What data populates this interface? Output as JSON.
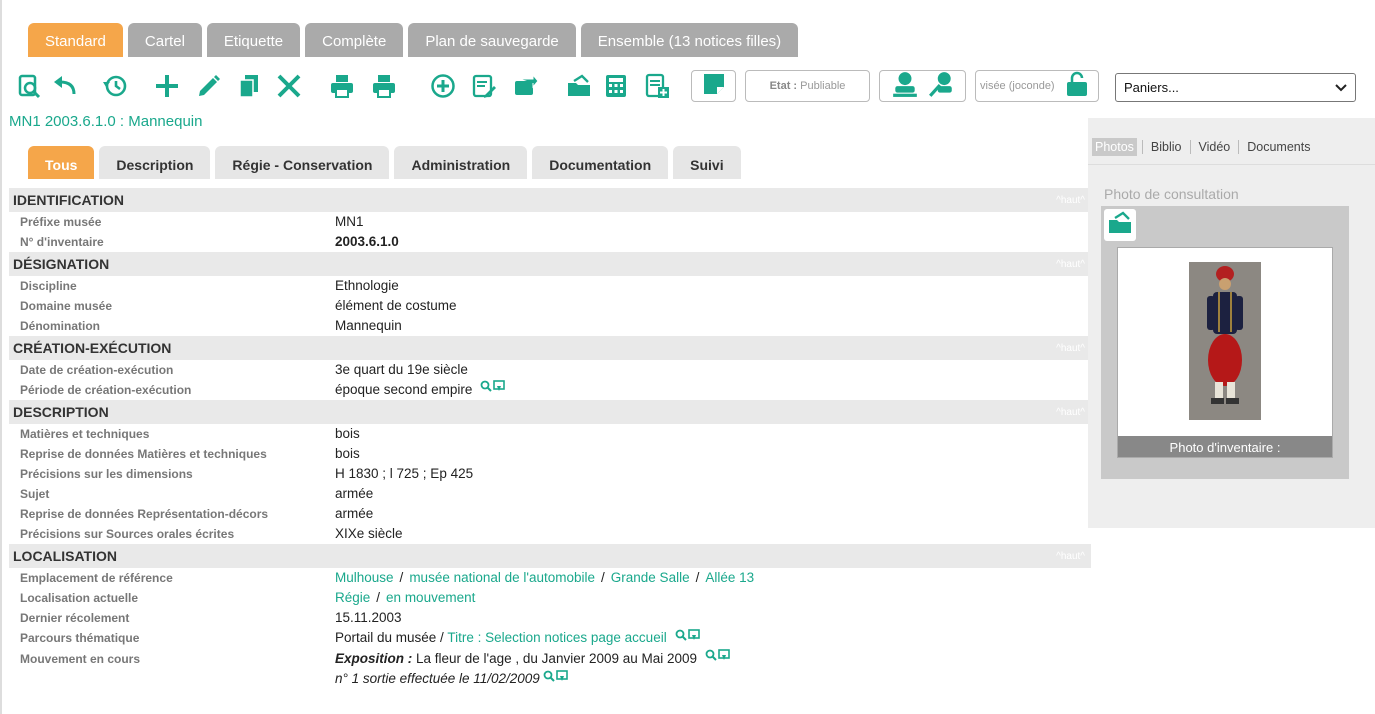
{
  "colors": {
    "accent": "#f5a64a",
    "teal": "#1aa88c",
    "inactive_tab": "#aaaaaa"
  },
  "top_tabs": [
    {
      "label": "Standard",
      "active": true
    },
    {
      "label": "Cartel"
    },
    {
      "label": "Etiquette"
    },
    {
      "label": "Complète"
    },
    {
      "label": "Plan de sauvegarde"
    },
    {
      "label": "Ensemble (13 notices filles)"
    }
  ],
  "toolbar": {
    "icons": [
      "search-document-icon",
      "undo-icon",
      "history-icon",
      "add-icon",
      "edit-icon",
      "copy-icon",
      "delete-icon",
      "print-icon",
      "print-alt-icon",
      "add-circle-icon",
      "edit-list-icon",
      "transfer-icon",
      "open-folder-icon",
      "calculator-icon",
      "document-add-icon",
      "note-icon",
      "user-icon",
      "user-search-icon",
      "lock-icon"
    ],
    "etat_prefix": "Etat :",
    "etat_value": "Publiable",
    "visee": "visée (joconde)",
    "paniers": "Paniers..."
  },
  "notice_title": "MN1 2003.6.1.0 : Mannequin",
  "sub_tabs": [
    {
      "label": "Tous",
      "active": true
    },
    {
      "label": "Description"
    },
    {
      "label": "Régie - Conservation"
    },
    {
      "label": "Administration"
    },
    {
      "label": "Documentation"
    },
    {
      "label": "Suivi"
    }
  ],
  "haut": "^haut^",
  "sections": {
    "identification": {
      "title": "IDENTIFICATION",
      "rows": [
        {
          "label": "Préfixe musée",
          "value": "MN1"
        },
        {
          "label": "N° d'inventaire",
          "value": "2003.6.1.0"
        }
      ]
    },
    "designation": {
      "title": "DÉSIGNATION",
      "rows": [
        {
          "label": "Discipline",
          "value": "Ethnologie"
        },
        {
          "label": "Domaine musée",
          "value": "élément de costume"
        },
        {
          "label": "Dénomination",
          "value": "Mannequin"
        }
      ]
    },
    "creation": {
      "title": "CRÉATION-EXÉCUTION",
      "rows": [
        {
          "label": "Date de création-exécution",
          "value": "3e quart du 19e siècle"
        },
        {
          "label": "Période de création-exécution",
          "value": "époque second empire"
        }
      ]
    },
    "description": {
      "title": "DESCRIPTION",
      "rows": [
        {
          "label": "Matières et techniques",
          "value": "bois"
        },
        {
          "label": "Reprise de données Matières et techniques",
          "value": "bois"
        },
        {
          "label": "Précisions sur les dimensions",
          "value": "H 1830 ; l 725 ; Ep 425"
        },
        {
          "label": "Sujet",
          "value": "armée"
        },
        {
          "label": "Reprise de données Représentation-décors",
          "value": "armée"
        },
        {
          "label": "Précisions sur Sources orales écrites",
          "value": "XIXe siècle"
        }
      ]
    },
    "localisation": {
      "title": "LOCALISATION",
      "emplacement_label": "Emplacement de référence",
      "emplacement": [
        "Mulhouse",
        "musée national de l'automobile",
        "Grande Salle",
        "Allée 13"
      ],
      "localisation_label": "Localisation actuelle",
      "localisation": [
        "Régie",
        "en mouvement"
      ],
      "recolement_label": "Dernier récolement",
      "recolement": "15.11.2003",
      "parcours_label": "Parcours thématique",
      "parcours_text": "Portail du musée /",
      "parcours_link": "Titre : Selection notices page accueil",
      "mouvement_label": "Mouvement en cours",
      "mouvement_bold": "Exposition :",
      "mouvement_text": "La fleur de l'age , du Janvier 2009 au Mai 2009",
      "mouvement_sortie": "n° 1 sortie effectuée le 11/02/2009"
    }
  },
  "sidebar": {
    "tabs": [
      {
        "label": "Photos",
        "active": true
      },
      {
        "label": "Biblio"
      },
      {
        "label": "Vidéo"
      },
      {
        "label": "Documents"
      }
    ],
    "photo_label": "Photo de consultation",
    "photo_caption": "Photo d'inventaire :"
  }
}
